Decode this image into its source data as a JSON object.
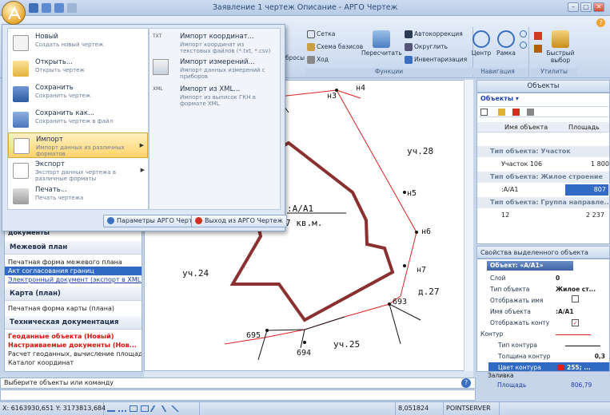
{
  "window": {
    "title": "Заявление 1 чертеж Описание - АРГО Чертеж",
    "minimize": "–",
    "maximize": "□",
    "close": "✕"
  },
  "ribbon": {
    "partial_button": "бросы",
    "groups": [
      {
        "label": "Функции",
        "buttons": [
          "Сетка",
          "Схема базисов",
          "Ход",
          "Пересчитать",
          "Автокоррекция",
          "Округлить",
          "Инвентаризация"
        ]
      },
      {
        "label": "Навигация",
        "buttons": [
          "Центр",
          "Рамка"
        ]
      },
      {
        "label": "Утилиты",
        "buttons": [
          "Быстрый выбор"
        ]
      }
    ],
    "help": "?"
  },
  "app_menu": {
    "items": [
      {
        "title": "Новый",
        "desc": "Создать новый чертеж"
      },
      {
        "title": "Открыть...",
        "desc": "Открыть чертеж"
      },
      {
        "title": "Сохранить",
        "desc": "Сохранить чертеж"
      },
      {
        "title": "Сохранить как...",
        "desc": "Сохранить чертеж в файл"
      },
      {
        "title": "Импорт",
        "desc": "Импорт данных из различных форматов",
        "arrow": "▶"
      },
      {
        "title": "Экспорт",
        "desc": "Экспорт данных чертежа в различные форматы",
        "arrow": "▶"
      },
      {
        "title": "Печать...",
        "desc": "Печать чертежа"
      }
    ],
    "submenu": [
      {
        "title": "Импорт координат...",
        "desc": "Импорт координат из текстовых файлов (*.txt, *.csv)",
        "badge": "TXT"
      },
      {
        "title": "Импорт измерений...",
        "desc": "Импорт данных измерений с приборов"
      },
      {
        "title": "Импорт из XML...",
        "desc": "Импорт из выписок ГКН в формате XML",
        "badge": "XML"
      }
    ],
    "params_button": "Параметры АРГО Чертеж",
    "exit_button": "Выход из АРГО Чертеж"
  },
  "left_panel": {
    "title_partial": "документы",
    "sections": [
      {
        "head": "Межевой план",
        "items": [
          {
            "text": "Печатная форма межевого плана",
            "style": "normal"
          },
          {
            "text": "Акт согласования границ",
            "style": "sel"
          },
          {
            "text": "Электронный документ (экспорт в XML)",
            "style": "link"
          }
        ]
      },
      {
        "head": "Карта (план)",
        "items": [
          {
            "text": "Печатная форма карты (плана)",
            "style": "normal"
          }
        ]
      },
      {
        "head": "Техническая документация",
        "items": [
          {
            "text": "Геоданные объекта (Новый)",
            "style": "red"
          },
          {
            "text": "Настраиваемые документы (Нов...",
            "style": "red"
          },
          {
            "text": "Расчет геоданных, вычисление площади",
            "style": "normal"
          },
          {
            "text": "Каталог координат",
            "style": "normal"
          }
        ]
      }
    ]
  },
  "drawing": {
    "labels": [
      "н3",
      "н4",
      "уч.28",
      "н5",
      "н6",
      "н7",
      "д.27",
      "693",
      "уч.24",
      "695",
      "694",
      "уч.25"
    ],
    "object_label": ":А/А1",
    "area_text": "7 кв.м."
  },
  "objects_panel": {
    "title": "Объекты",
    "dropdown": "Объекты",
    "col_name": "Имя объекта",
    "col_area": "Площадь",
    "rows": [
      {
        "type": "group",
        "text": "Тип объекта: Участок"
      },
      {
        "type": "item",
        "name": "Участок 106",
        "area": "1 800"
      },
      {
        "type": "group",
        "text": "Тип объекта: Жилое строение"
      },
      {
        "type": "item",
        "name": ":А/А1",
        "area": "807",
        "selected": true
      },
      {
        "type": "group",
        "text": "Тип объекта: Группа направле..."
      },
      {
        "type": "item",
        "name": "12",
        "area": "2 237"
      }
    ]
  },
  "properties_panel": {
    "title": "Свойства выделенного объекта",
    "object_header": "Объект: «А/А1»",
    "rows": [
      {
        "k": "Слой",
        "v": "0"
      },
      {
        "k": "Тип объекта",
        "v": "Жилое ст..."
      },
      {
        "k": "Отображать имя",
        "v": ""
      },
      {
        "k": "Имя объекта",
        "v": ":А/А1"
      },
      {
        "k": "Отображать конту",
        "v": "✓"
      },
      {
        "k": "Контур",
        "v": ""
      },
      {
        "k": "Тип контура",
        "v": ""
      },
      {
        "k": "Толщина контур",
        "v": "0,3"
      },
      {
        "k": "Цвет контура",
        "v": "255; ..."
      },
      {
        "k": "Заливка",
        "v": ""
      },
      {
        "k": "Площадь",
        "v": "806,79"
      }
    ]
  },
  "cmdline": {
    "text": "Выберите объекты или команду"
  },
  "statusbar": {
    "coords": "X: 6163930,651 Y: 3173813,684",
    "scale": "8,051824",
    "server": "POINTSERVER"
  },
  "colors": {
    "parcel": "#e02020",
    "building": "#8a3030",
    "accent": "#316ac5"
  }
}
